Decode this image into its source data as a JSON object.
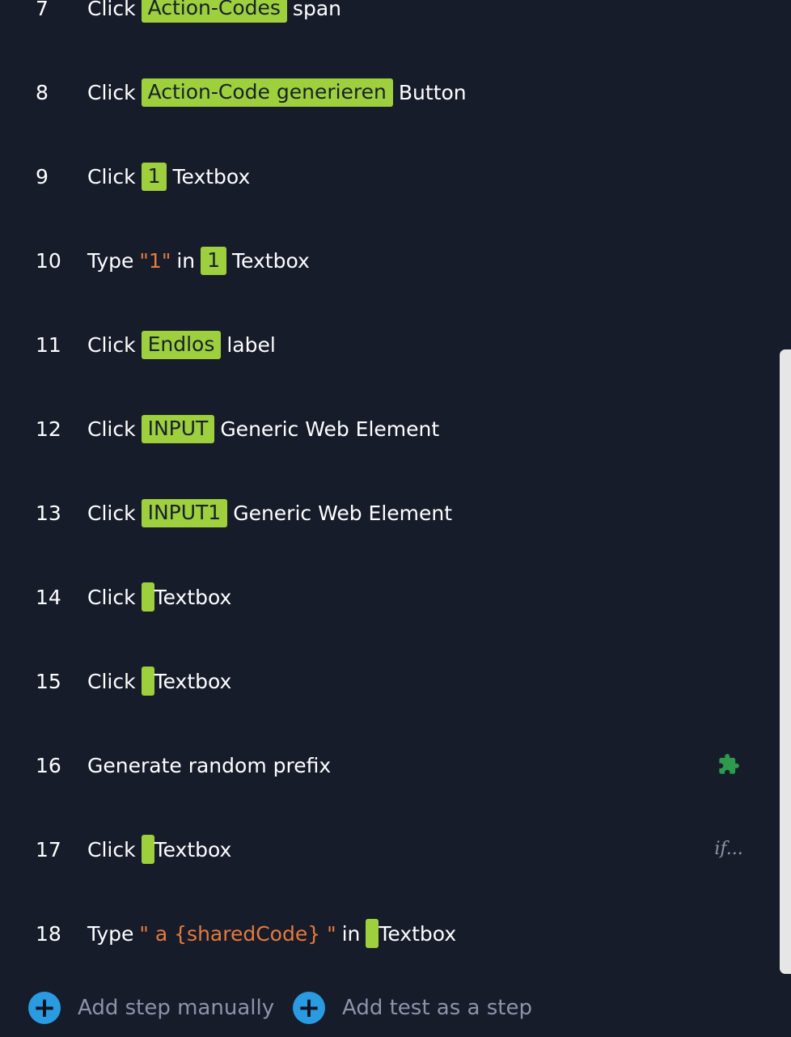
{
  "steps": [
    {
      "num": "7",
      "parts": [
        {
          "t": "text",
          "v": "Click"
        },
        {
          "t": "chip",
          "v": "Action-Codes"
        },
        {
          "t": "text",
          "v": "span"
        }
      ]
    },
    {
      "num": "8",
      "parts": [
        {
          "t": "text",
          "v": "Click"
        },
        {
          "t": "chip",
          "v": "Action-Code generieren"
        },
        {
          "t": "text",
          "v": "Button"
        }
      ]
    },
    {
      "num": "9",
      "parts": [
        {
          "t": "text",
          "v": "Click"
        },
        {
          "t": "chip",
          "v": "1"
        },
        {
          "t": "text",
          "v": "Textbox"
        }
      ]
    },
    {
      "num": "10",
      "parts": [
        {
          "t": "text",
          "v": "Type"
        },
        {
          "t": "quote",
          "v": "\"1\""
        },
        {
          "t": "text",
          "v": "in"
        },
        {
          "t": "chip",
          "v": "1"
        },
        {
          "t": "text",
          "v": "Textbox"
        }
      ]
    },
    {
      "num": "11",
      "parts": [
        {
          "t": "text",
          "v": "Click"
        },
        {
          "t": "chip",
          "v": "Endlos"
        },
        {
          "t": "text",
          "v": "label"
        }
      ]
    },
    {
      "num": "12",
      "parts": [
        {
          "t": "text",
          "v": "Click"
        },
        {
          "t": "chip",
          "v": "INPUT"
        },
        {
          "t": "text",
          "v": "Generic Web Element"
        }
      ]
    },
    {
      "num": "13",
      "parts": [
        {
          "t": "text",
          "v": "Click"
        },
        {
          "t": "chip",
          "v": "INPUT1"
        },
        {
          "t": "text",
          "v": "Generic Web Element"
        }
      ]
    },
    {
      "num": "14",
      "parts": [
        {
          "t": "text",
          "v": "Click"
        },
        {
          "t": "chip",
          "v": ""
        },
        {
          "t": "text",
          "v": "Textbox"
        }
      ]
    },
    {
      "num": "15",
      "parts": [
        {
          "t": "text",
          "v": "Click"
        },
        {
          "t": "chip",
          "v": ""
        },
        {
          "t": "text",
          "v": "Textbox"
        }
      ]
    },
    {
      "num": "16",
      "parts": [
        {
          "t": "text",
          "v": "Generate random prefix"
        }
      ],
      "icon": "puzzle-icon"
    },
    {
      "num": "17",
      "parts": [
        {
          "t": "text",
          "v": "Click"
        },
        {
          "t": "chip",
          "v": ""
        },
        {
          "t": "text",
          "v": "Textbox"
        }
      ],
      "icon": "if-condition-icon",
      "icon_text": "if..."
    },
    {
      "num": "18",
      "parts": [
        {
          "t": "text",
          "v": "Type"
        },
        {
          "t": "quote",
          "v": "\" a {sharedCode} \""
        },
        {
          "t": "text",
          "v": "in"
        },
        {
          "t": "chip",
          "v": ""
        },
        {
          "t": "text",
          "v": "Textbox"
        }
      ]
    }
  ],
  "footer": {
    "add_step_label": "Add step manually",
    "add_test_label": "Add test as a step",
    "add_icon": "+"
  },
  "colors": {
    "background": "#171c2b",
    "chip": "#9ecf3d",
    "quote": "#e67a3c",
    "add_button": "#2a9be0",
    "puzzle_icon": "#2e9a4e"
  }
}
